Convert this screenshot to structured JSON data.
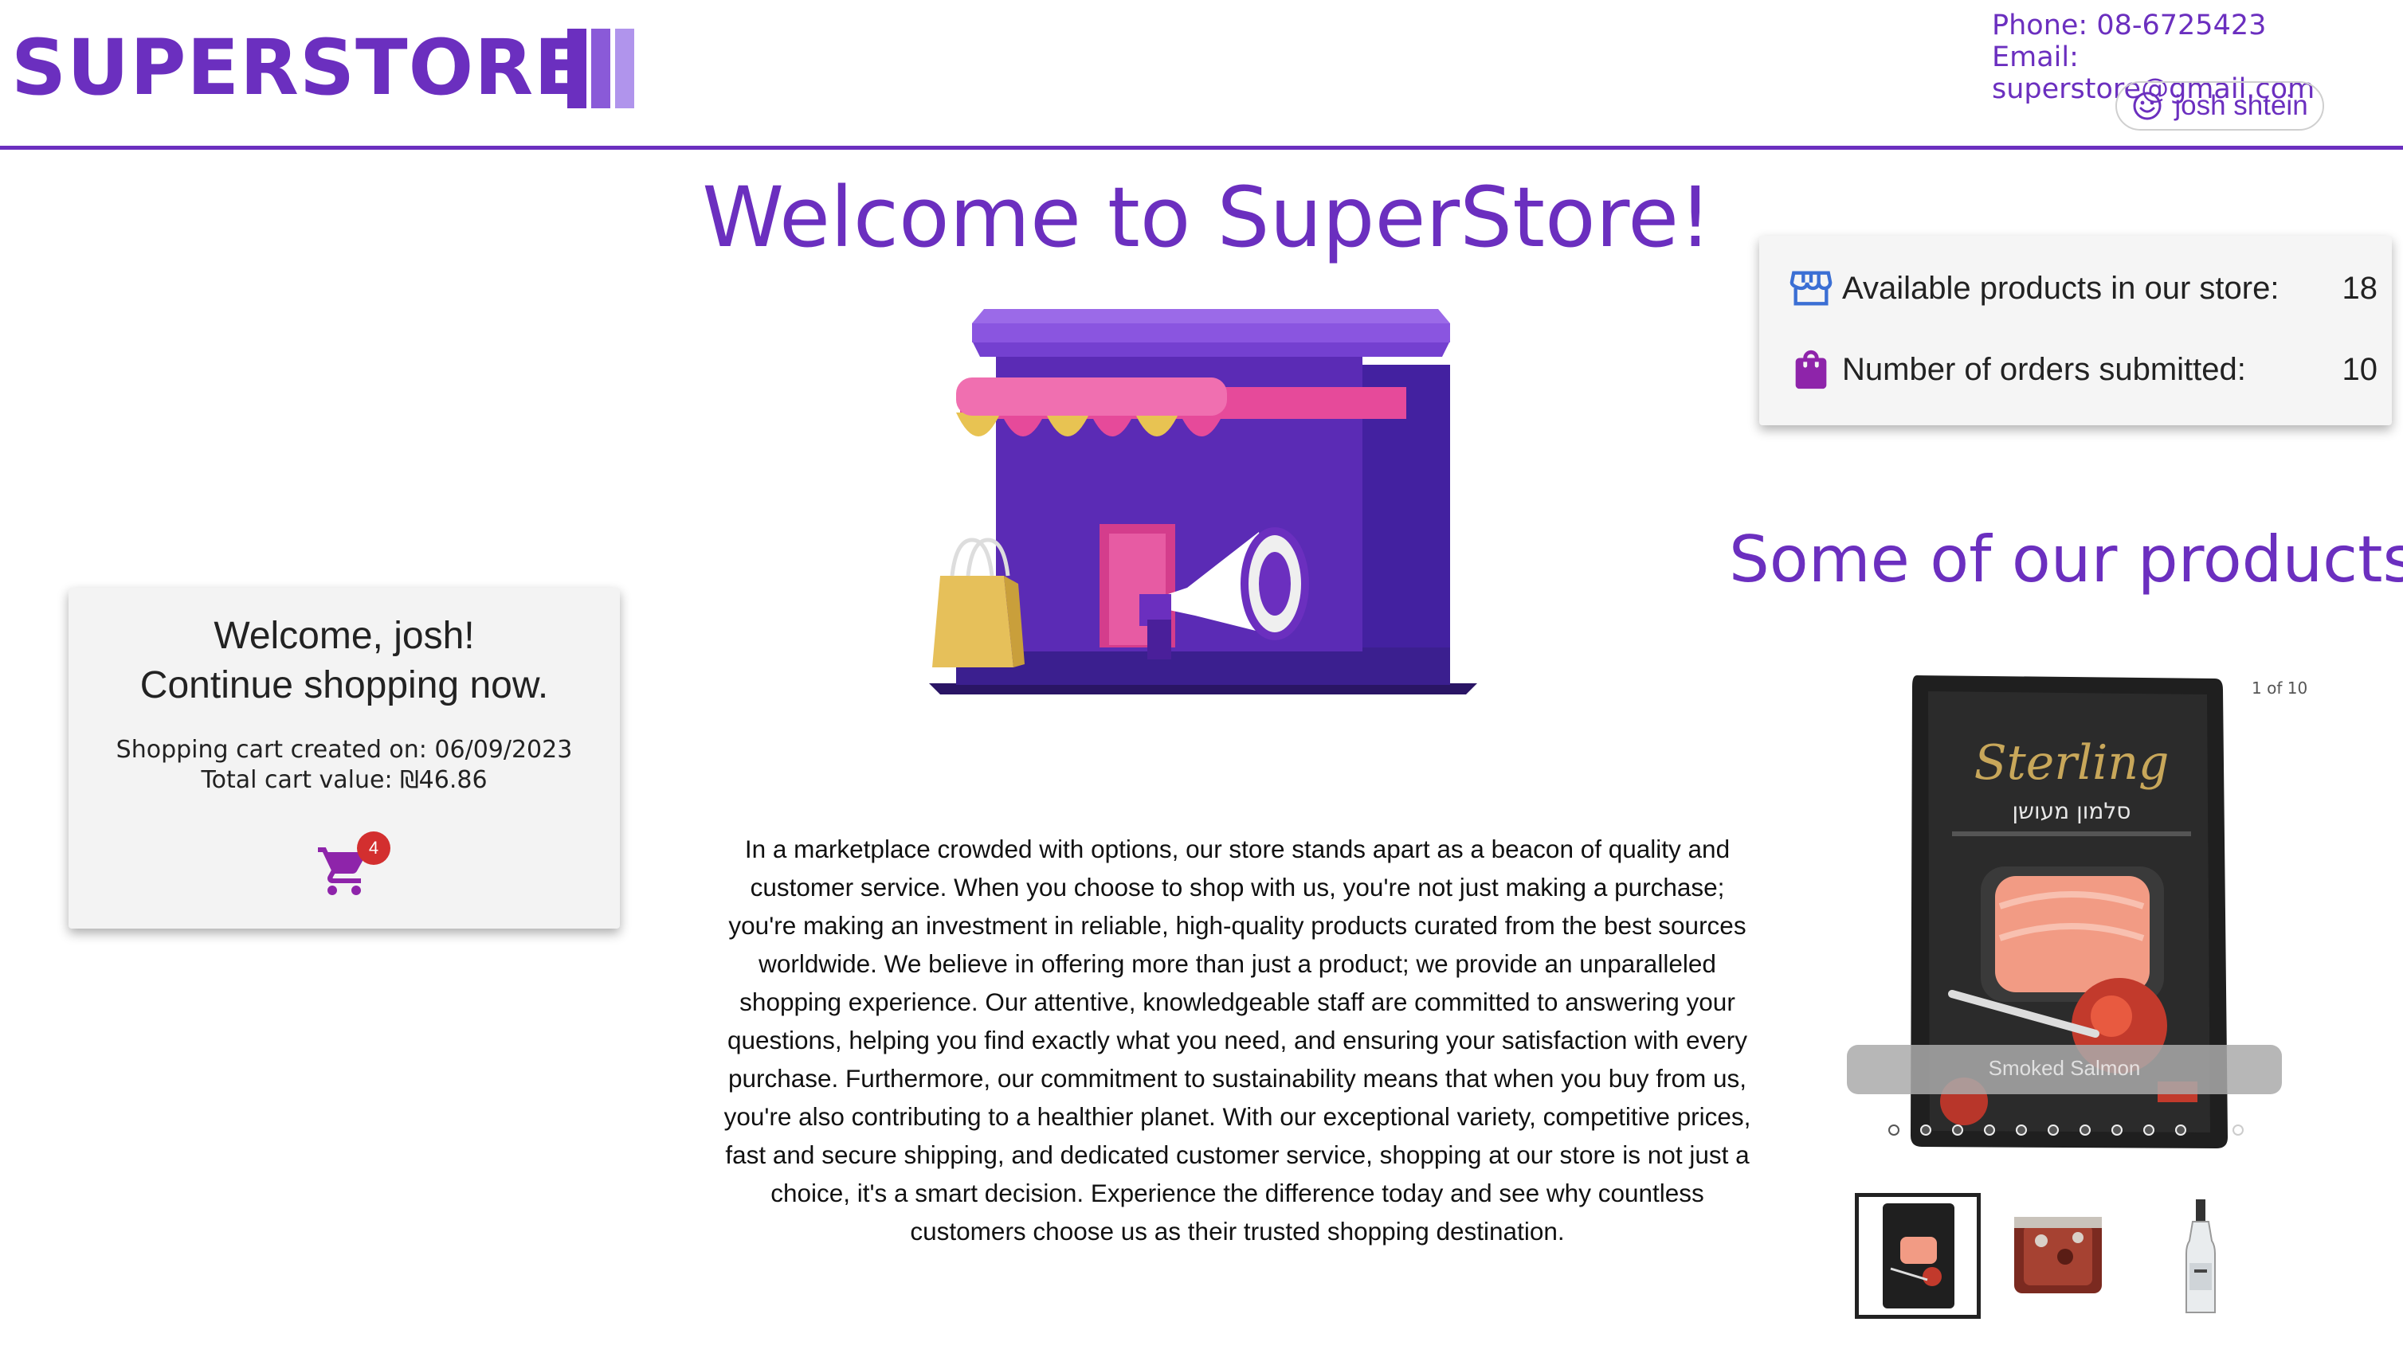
{
  "brand": {
    "name": "SUPERSTORE",
    "color": "#6b2fbf"
  },
  "contact": {
    "phone": "Phone: 08-6725423",
    "email": "Email: superstore@gmail.com"
  },
  "user": {
    "name": "josh shtein",
    "icon": "smiley-face-icon"
  },
  "hero": {
    "title": "Welcome to SuperStore!",
    "image": "storefront-illustration"
  },
  "welcome_card": {
    "greeting": "Welcome, josh!",
    "cta": "Continue shopping now.",
    "cart_created": "Shopping cart created on: 06/09/2023",
    "cart_total": "Total cart value: ₪46.86",
    "cart_badge_count": "4",
    "cart_icon": "shopping-cart-icon"
  },
  "stats": [
    {
      "label": "Available products in our store:",
      "value": "18",
      "icon": "store-icon"
    },
    {
      "label": "Number of orders submitted:",
      "value": "10",
      "icon": "shopping-bag-icon"
    }
  ],
  "description": "In a marketplace crowded with options, our store stands apart as a beacon of quality and customer service. When you choose to shop with us, you're not just making a purchase; you're making an investment in reliable, high-quality products curated from the best sources worldwide. We believe in offering more than just a product; we provide an unparalleled shopping experience. Our attentive, knowledgeable staff are committed to answering your questions, helping you find exactly what you need, and ensuring your satisfaction with every purchase. Furthermore, our commitment to sustainability means that when you buy from us, you're also contributing to a healthier planet. With our exceptional variety, competitive prices, fast and secure shipping, and dedicated customer service, shopping at our store is not just a choice, it's a smart decision. Experience the difference today and see why countless customers choose us as their trusted shopping destination.",
  "products_section": {
    "title": "Some of our products",
    "slide_counter": "1 of 10",
    "current_caption": "Smoked Salmon",
    "product_brand": "Sterling",
    "product_hebrew": "סלמון מעושן",
    "dot_count": 10,
    "thumbnails": [
      "smoked-salmon",
      "meat-package",
      "vodka-bottle"
    ]
  }
}
